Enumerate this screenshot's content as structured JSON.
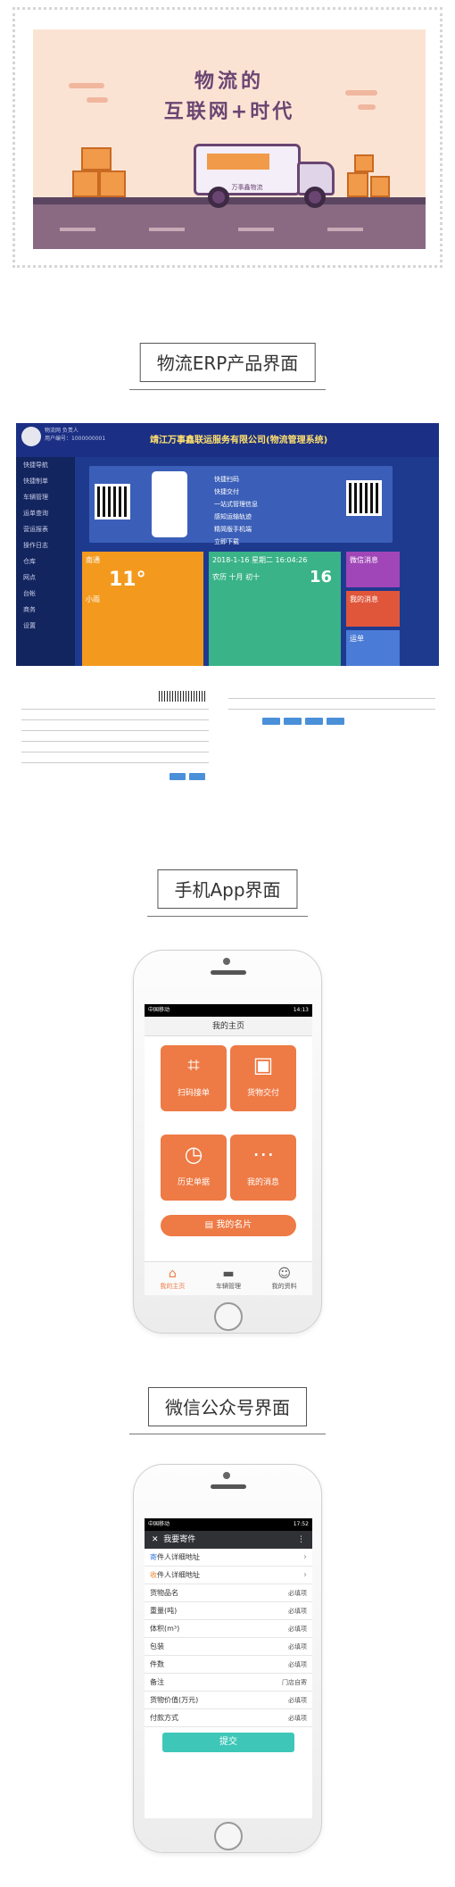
{
  "banner": {
    "title_line1": "物流的",
    "title_line2": "互联网+时代",
    "truck_label": "万事鑫物流"
  },
  "sections": {
    "erp": "物流ERP产品界面",
    "app": "手机App界面",
    "wechat": "微信公众号界面"
  },
  "erp": {
    "company": "靖江万事鑫联运服务有限公司(物流管理系统)",
    "user": "物流网 负责人",
    "user_id": "用户编号：1000000001",
    "sidebar": [
      "快捷导航",
      "快捷制单",
      "车辆管理",
      "运单查询",
      "营运报表",
      "操作日志",
      "仓库",
      "网点",
      "台帐",
      "商务",
      "设置"
    ],
    "banner_lines": [
      "快捷扫码",
      "快捷交付",
      "一站式管理信息",
      "感知运输轨迹",
      "精简版手机端",
      "立即下载"
    ],
    "weather_city": "南通",
    "weather_temp": "11°",
    "weather_desc": "小雨",
    "date_line": "2018-1-16 星期二 16:04:26",
    "lunar": "农历 十月 初十",
    "day": "16",
    "tile_labels": [
      "微信消息",
      "我的消息",
      "运单"
    ]
  },
  "app": {
    "status_left": "中国移动",
    "status_right": "14:13",
    "header": "我的主页",
    "tiles": [
      {
        "icon": "scan-icon",
        "label": "扫码接单"
      },
      {
        "icon": "package-icon",
        "label": "货物交付"
      },
      {
        "icon": "clock-icon",
        "label": "历史单据"
      },
      {
        "icon": "message-icon",
        "label": "我的消息"
      }
    ],
    "card_button": "我的名片",
    "tabs": [
      {
        "icon": "home-icon",
        "label": "我的主页"
      },
      {
        "icon": "truck-icon",
        "label": "车辆管理"
      },
      {
        "icon": "user-icon",
        "label": "我的资料"
      }
    ]
  },
  "wechat": {
    "status_left": "中国移动",
    "status_right": "17:52",
    "header": "我要寄件",
    "rows": [
      {
        "label_prefix": "寄",
        "label": "件人详细地址",
        "value": "",
        "arrow": true,
        "color": "blue"
      },
      {
        "label_prefix": "收",
        "label": "件人详细地址",
        "value": "",
        "arrow": true,
        "color": "orange"
      },
      {
        "label_prefix": "",
        "label": "货物品名",
        "value": "必填项"
      },
      {
        "label_prefix": "",
        "label": "重量(吨)",
        "value": "必填项"
      },
      {
        "label_prefix": "",
        "label": "体积(m³)",
        "value": "必填项"
      },
      {
        "label_prefix": "",
        "label": "包装",
        "value": "必填项"
      },
      {
        "label_prefix": "",
        "label": "件数",
        "value": "必填项"
      },
      {
        "label_prefix": "",
        "label": "备注",
        "value": "门店自寄"
      },
      {
        "label_prefix": "",
        "label": "货物价值(万元)",
        "value": "必填项"
      },
      {
        "label_prefix": "",
        "label": "付款方式",
        "value": "必填项"
      }
    ],
    "submit": "提交"
  }
}
